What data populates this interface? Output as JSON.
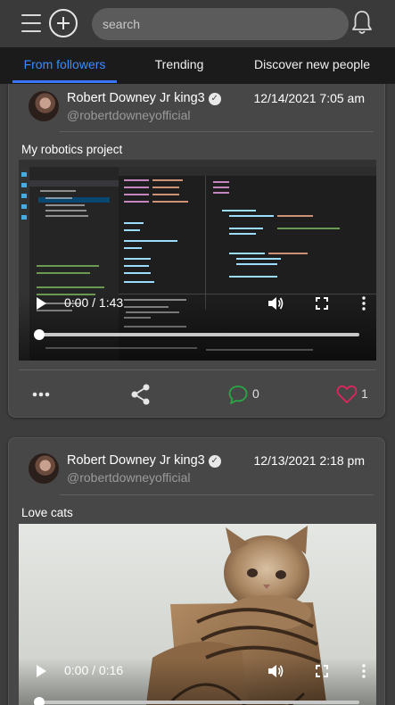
{
  "header": {
    "search_placeholder": "search",
    "icons": [
      "menu-icon",
      "add-circle-icon",
      "bell-icon"
    ]
  },
  "tabs": [
    {
      "label": "From followers",
      "active": true
    },
    {
      "label": "Trending",
      "active": false
    },
    {
      "label": "Discover new people",
      "active": false
    }
  ],
  "posts": [
    {
      "author": "Robert Downey Jr king3",
      "handle": "@robertdowneyofficial",
      "timestamp": "12/14/2021 7:05 am",
      "caption": "My robotics project",
      "video": {
        "time": "0:00 / 1:43",
        "progress": 0
      },
      "comments": "0",
      "likes": "1"
    },
    {
      "author": "Robert Downey Jr king3",
      "handle": "@robertdowneyofficial",
      "timestamp": "12/13/2021 2:18 pm",
      "caption": "Love cats",
      "video": {
        "time": "0:00 / 0:16",
        "progress": 0
      }
    }
  ],
  "colors": {
    "accent": "#3a8cff",
    "comment": "#28a745",
    "like": "#e0245e",
    "card": "#474747",
    "background": "#3d3d3d"
  }
}
